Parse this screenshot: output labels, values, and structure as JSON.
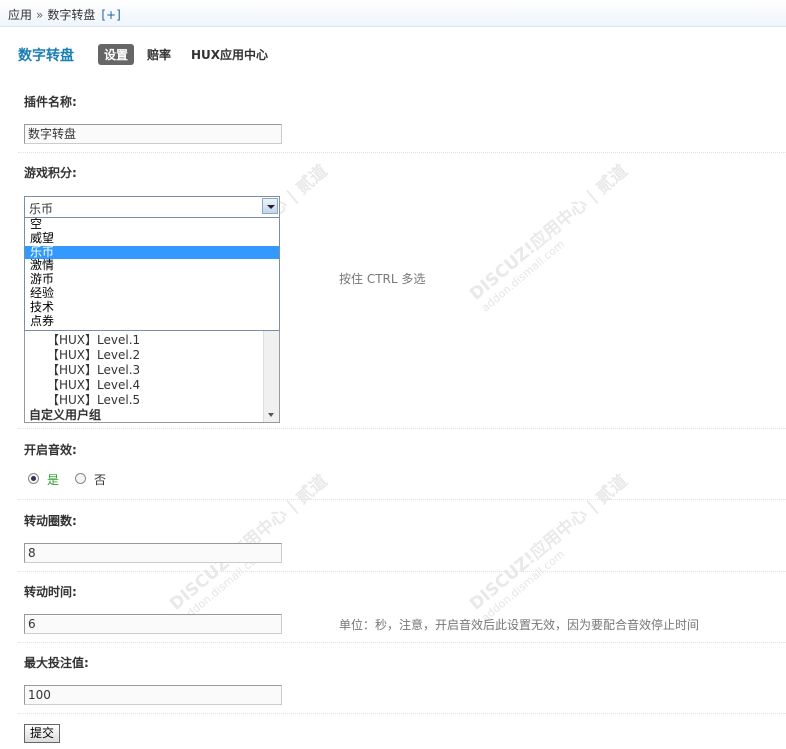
{
  "breadcrumb": {
    "root": "应用",
    "sep": "»",
    "current": "数字转盘",
    "add": "[+]"
  },
  "header": {
    "title": "数字转盘",
    "tabs": [
      {
        "label": "设置",
        "active": true
      },
      {
        "label": "赔率",
        "active": false
      },
      {
        "label": "HUX应用中心",
        "active": false
      }
    ]
  },
  "form": {
    "plugin_name": {
      "label": "插件名称:",
      "value": "数字转盘"
    },
    "game_credit": {
      "label": "游戏积分:",
      "selected": "乐币",
      "options": [
        "空",
        "威望",
        "乐币",
        "激情",
        "游币",
        "经验",
        "技术",
        "点券"
      ]
    },
    "user_groups": {
      "hint": "按住 CTRL 多选",
      "items": [
        "【HUX】Level.1",
        "【HUX】Level.2",
        "【HUX】Level.3",
        "【HUX】Level.4",
        "【HUX】Level.5"
      ],
      "group": "自定义用户组"
    },
    "sound": {
      "label": "开启音效:",
      "yes": "是",
      "no": "否",
      "value": "是"
    },
    "spin_rounds": {
      "label": "转动圈数:",
      "value": "8"
    },
    "spin_time": {
      "label": "转动时间:",
      "value": "6",
      "hint": "单位：秒，注意，开启音效后此设置无效，因为要配合音效停止时间"
    },
    "max_bet": {
      "label": "最大投注值:",
      "value": "100"
    },
    "submit": "提交"
  },
  "watermark": {
    "text": "DISCUZ!应用中心 | 贰道",
    "sub": "addon.dismall.com"
  },
  "colors": {
    "accent": "#1b7fb4",
    "selected_option": "#3399ff",
    "yes_label": "#2a9d2a"
  }
}
